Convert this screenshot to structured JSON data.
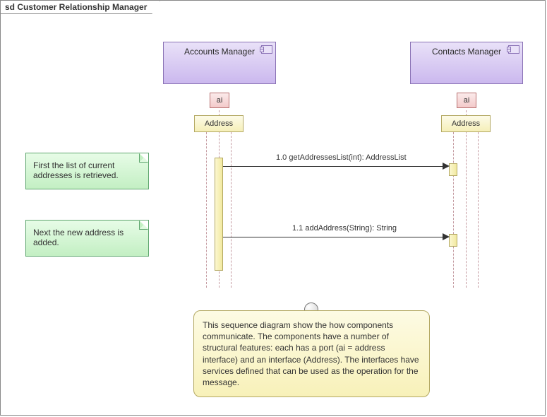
{
  "frame": {
    "title": "sd Customer Relationship Manager"
  },
  "components": {
    "accounts": {
      "name": "Accounts Manager",
      "port": "ai",
      "iface": "Address"
    },
    "contacts": {
      "name": "Contacts Manager",
      "port": "ai",
      "iface": "Address"
    }
  },
  "messages": {
    "m1": {
      "label": "1.0 getAddressesList(int): AddressList"
    },
    "m2": {
      "label": "1.1 addAddress(String): String"
    }
  },
  "notes": {
    "n1": "First the list of current addresses is retrieved.",
    "n2": "Next the new address is added.",
    "constraint": "This sequence diagram show the how components communicate. The components have a number of structural features: each has a port (ai = address interface) and an interface (Address). The interfaces have services defined that can be used as the operation for the message."
  }
}
